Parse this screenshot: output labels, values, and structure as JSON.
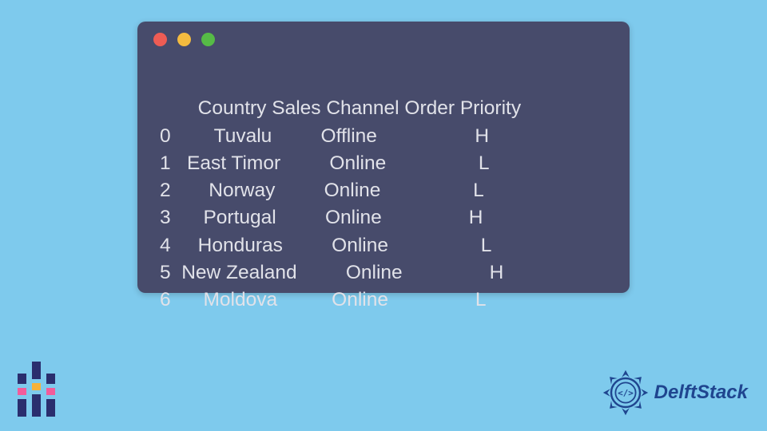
{
  "terminal": {
    "dots": [
      "red",
      "yellow",
      "green"
    ],
    "headers": [
      "",
      "Country",
      "Sales Channel",
      "Order Priority"
    ],
    "rows": [
      {
        "idx": "0",
        "country": "Tuvalu",
        "channel": "Offline",
        "priority": "H"
      },
      {
        "idx": "1",
        "country": "East Timor",
        "channel": "Online",
        "priority": "L"
      },
      {
        "idx": "2",
        "country": "Norway",
        "channel": "Online",
        "priority": "L"
      },
      {
        "idx": "3",
        "country": "Portugal",
        "channel": "Online",
        "priority": "H"
      },
      {
        "idx": "4",
        "country": "Honduras",
        "channel": "Online",
        "priority": "L"
      },
      {
        "idx": "5",
        "country": "New Zealand",
        "channel": "Online",
        "priority": "H"
      },
      {
        "idx": "6",
        "country": "Moldova",
        "channel": "Online",
        "priority": "L"
      }
    ],
    "render_lines": {
      "h": "       Country Sales Channel Order Priority",
      "r0": "0        Tuvalu         Offline                  H",
      "r1": "1   East Timor         Online                 L",
      "r2": "2       Norway         Online                 L",
      "r3": "3      Portugal         Online                H",
      "r4": "4     Honduras         Online                 L",
      "r5": "5  New Zealand         Online                H",
      "r6": "6      Moldova          Online                L"
    }
  },
  "brand": {
    "name": "DelftStack"
  },
  "colors": {
    "page_bg": "#7ecaed",
    "terminal_bg": "#474b6b",
    "terminal_fg": "#e1e2e9",
    "brand_blue": "#1f458f"
  }
}
